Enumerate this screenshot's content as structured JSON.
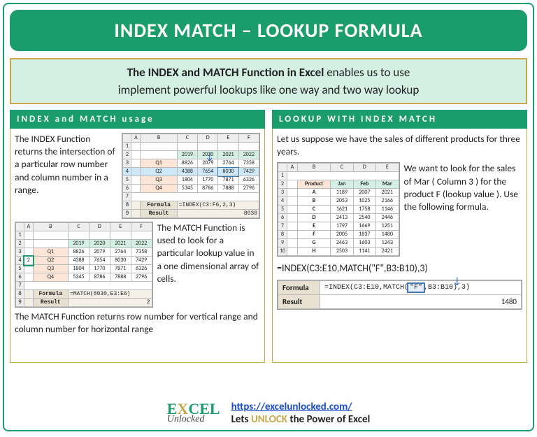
{
  "title": "INDEX MATCH – LOOKUP FORMULA",
  "intro": {
    "bold": "The INDEX and MATCH Function in Excel",
    "rest1": " enables us to use",
    "line2": "implement powerful lookups like one way and two way lookup"
  },
  "left": {
    "header": "INDEX and MATCH usage",
    "text1": "The INDEX Function returns the intersection of a particular row number and column number in a range.",
    "text2": "The MATCH Function is used to look for a particular lookup value in a one dimensional array of cells.",
    "text3": "The MATCH Function returns row number for vertical range and column number for horizontal range",
    "index_table": {
      "cols": [
        "A",
        "B",
        "C",
        "D",
        "E",
        "F"
      ],
      "years": [
        "2019",
        "2020",
        "2021",
        "2022"
      ],
      "rows": [
        {
          "q": "Q1",
          "v": [
            "8826",
            "2079",
            "2764",
            "7358"
          ]
        },
        {
          "q": "Q2",
          "v": [
            "4388",
            "7654",
            "8030",
            "7429"
          ]
        },
        {
          "q": "Q3",
          "v": [
            "1804",
            "1770",
            "7871",
            "6326"
          ]
        },
        {
          "q": "Q4",
          "v": [
            "5345",
            "8786",
            "7888",
            "2796"
          ]
        }
      ],
      "formula_label": "Formula",
      "formula": "=INDEX(C3:F6,2,3)",
      "result_label": "Result",
      "result": "8030"
    },
    "match_table": {
      "cols": [
        "A",
        "B",
        "C",
        "D",
        "E",
        "F"
      ],
      "years": [
        "2019",
        "2020",
        "2021",
        "2022"
      ],
      "rows": [
        {
          "q": "Q1",
          "v": [
            "8826",
            "2079",
            "2764",
            "7358"
          ]
        },
        {
          "q": "Q2",
          "v": [
            "4388",
            "7654",
            "8030",
            "7429"
          ]
        },
        {
          "q": "Q3",
          "v": [
            "1804",
            "1770",
            "7871",
            "6326"
          ]
        },
        {
          "q": "Q4",
          "v": [
            "5345",
            "8786",
            "7888",
            "2796"
          ]
        }
      ],
      "sel_row": "2",
      "formula_label": "Formula",
      "formula": "=MATCH(8030,E3:E6)",
      "result_label": "Result",
      "result": "2"
    }
  },
  "right": {
    "header": "LOOKUP WITH INDEX MATCH",
    "text1": "Let us suppose we have the sales of different products for three years.",
    "text2": "We want to look for the sales of Mar ( Column 3 ) for the product F (lookup value ). Use the following formula.",
    "products_table": {
      "cols": [
        "A",
        "B",
        "C",
        "D",
        "E"
      ],
      "headers": [
        "Product",
        "Jan",
        "Feb",
        "Mar"
      ],
      "rows": [
        {
          "p": "A",
          "v": [
            "1189",
            "2007",
            "2021"
          ]
        },
        {
          "p": "B",
          "v": [
            "2053",
            "1025",
            "2166"
          ]
        },
        {
          "p": "C",
          "v": [
            "1621",
            "1758",
            "1146"
          ]
        },
        {
          "p": "D",
          "v": [
            "2413",
            "2540",
            "2446"
          ]
        },
        {
          "p": "E",
          "v": [
            "1797",
            "1669",
            "1251"
          ]
        },
        {
          "p": "F",
          "v": [
            "2005",
            "1837",
            "1480"
          ]
        },
        {
          "p": "G",
          "v": [
            "2463",
            "1603",
            "1243"
          ]
        },
        {
          "p": "H",
          "v": [
            "2503",
            "1141",
            "2421"
          ]
        }
      ]
    },
    "formula_text": "=INDEX(C3:E10,MATCH(\"F\",B3:B10),3)",
    "result_box": {
      "formula_label": "Formula",
      "formula_pre": "=INDEX(C3:E10,MATCH(",
      "formula_hl": "\"F\"",
      "formula_post": ",B3:B10),3)",
      "result_label": "Result",
      "result": "1480"
    }
  },
  "footer": {
    "logo_top1": "E",
    "logo_top2": "X",
    "logo_top3": "CEL",
    "logo_bot": "Unlocked",
    "url": "https://excelunlocked.com/",
    "tag_pre": "Lets ",
    "tag_unl": "UNLOCK",
    "tag_post": " the Power of Excel"
  }
}
